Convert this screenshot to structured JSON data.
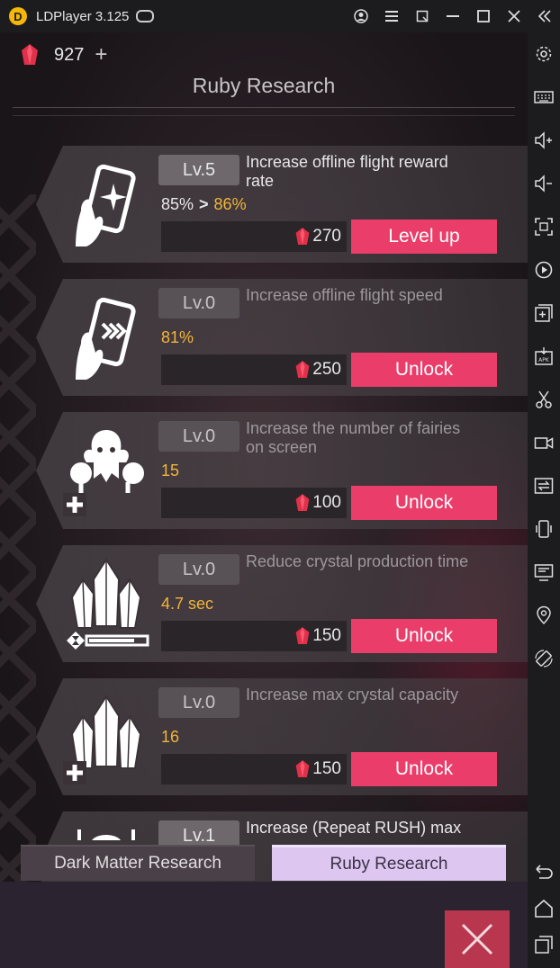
{
  "titlebar": {
    "app_title": "LDPlayer 3.125",
    "logo_letter": "D"
  },
  "header": {
    "ruby_count": "927",
    "plus_label": "+",
    "title": "Ruby Research"
  },
  "research_items": [
    {
      "level": "Lv.5",
      "desc_line1": "Increase offline flight reward",
      "desc_line2": "rate",
      "value_current": "85%",
      "value_next": "86%",
      "cost": "270",
      "action": "Level up",
      "active": true
    },
    {
      "level": "Lv.0",
      "desc_line1": "Increase offline flight speed",
      "desc_line2": "",
      "value": "81%",
      "cost": "250",
      "action": "Unlock",
      "active": false
    },
    {
      "level": "Lv.0",
      "desc_line1": "Increase the number of fairies",
      "desc_line2": "on screen",
      "value": "15",
      "cost": "100",
      "action": "Unlock",
      "active": false
    },
    {
      "level": "Lv.0",
      "desc_line1": "Reduce crystal production time",
      "desc_line2": "",
      "value": "4.7 sec",
      "cost": "150",
      "action": "Unlock",
      "active": false
    },
    {
      "level": "Lv.0",
      "desc_line1": "Increase max crystal capacity",
      "desc_line2": "",
      "value": "16",
      "cost": "150",
      "action": "Unlock",
      "active": false
    },
    {
      "level": "Lv.1",
      "desc_line1": "Increase (Repeat RUSH) max",
      "desc_line2": "",
      "value": "",
      "cost": "",
      "action": "",
      "active": true
    }
  ],
  "tabs": {
    "dark_matter": "Dark Matter Research",
    "ruby": "Ruby Research",
    "selected": "ruby"
  },
  "colors": {
    "accent_button": "#ea3d6a",
    "value_text": "#f2b53a",
    "selected_tab": "#ddc7f0",
    "ruby": "#e0304a"
  },
  "icons": {
    "titlebar": [
      "user-icon",
      "menu-icon",
      "window-icon",
      "minimize-icon",
      "maximize-icon",
      "close-icon",
      "collapse-icon"
    ],
    "sidebar": [
      "settings-icon",
      "keyboard-icon",
      "volume-up-icon",
      "volume-down-icon",
      "screenshot-icon",
      "record-icon",
      "add-window-icon",
      "apk-install-icon",
      "scissors-icon",
      "video-icon",
      "sync-icon",
      "shake-icon",
      "monitor-icon",
      "location-icon",
      "rotate-icon",
      "back-icon",
      "home-icon",
      "recent-apps-icon"
    ]
  }
}
